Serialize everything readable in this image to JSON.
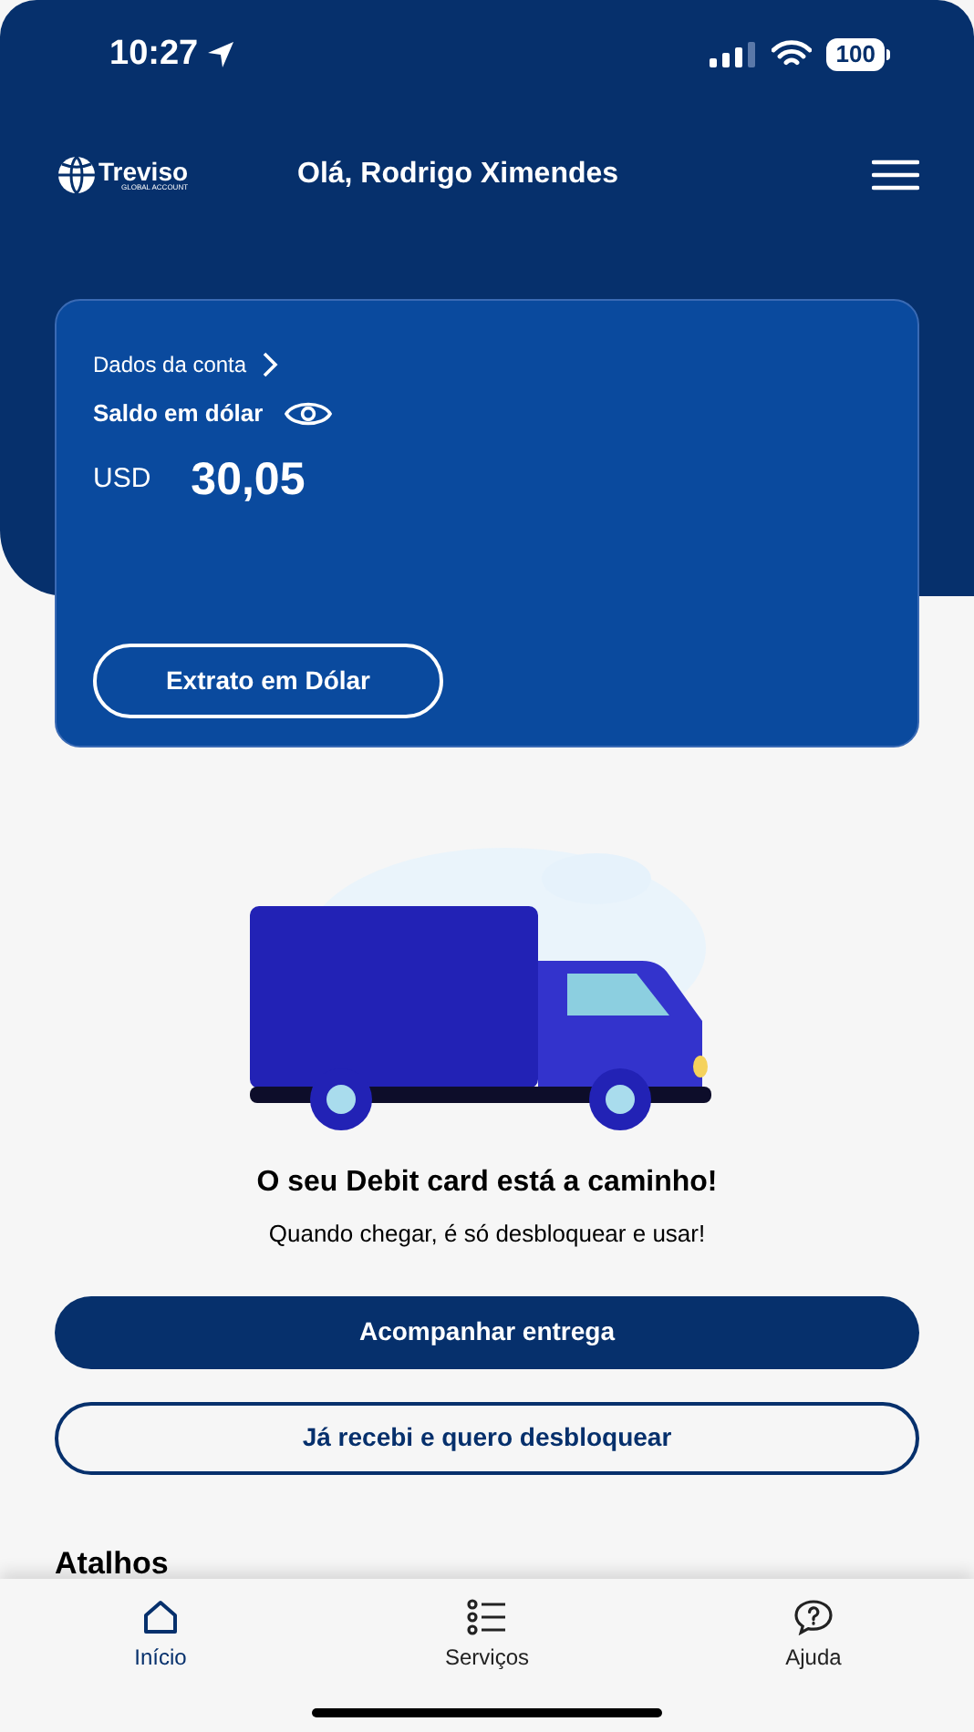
{
  "status_bar": {
    "time": "10:27",
    "battery": "100"
  },
  "header": {
    "logo": "Treviso",
    "logo_tagline": "GLOBAL ACCOUNT",
    "greeting": "Olá, Rodrigo Ximendes"
  },
  "account_card": {
    "link": "Dados da conta",
    "balance_label": "Saldo em dólar",
    "currency": "USD",
    "amount": "30,05",
    "button": "Extrato em Dólar"
  },
  "delivery": {
    "title": "O seu Debit card está a caminho!",
    "subtitle": "Quando chegar, é só desbloquear e usar!",
    "primary_button": "Acompanhar entrega",
    "secondary_button": "Já recebi e quero desbloquear"
  },
  "shortcuts": {
    "title": "Atalhos"
  },
  "tab_bar": [
    {
      "label": "Início",
      "kind": "home",
      "selected": true
    },
    {
      "label": "Serviços",
      "kind": "list",
      "selected": false
    },
    {
      "label": "Ajuda",
      "kind": "help",
      "selected": false
    }
  ]
}
